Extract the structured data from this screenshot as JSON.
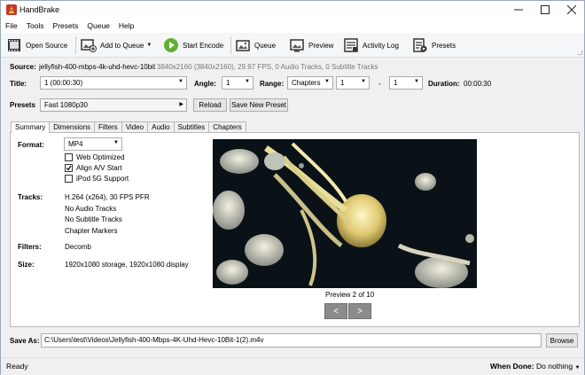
{
  "window": {
    "title": "HandBrake"
  },
  "menu": [
    "File",
    "Tools",
    "Presets",
    "Queue",
    "Help"
  ],
  "toolbar": {
    "open_source": "Open Source",
    "add_to_queue": "Add to Queue",
    "start_encode": "Start Encode",
    "queue": "Queue",
    "preview": "Preview",
    "activity_log": "Activity Log",
    "presets": "Presets"
  },
  "source": {
    "label": "Source:",
    "name": "jellyfish-400-mbps-4k-uhd-hevc-10bit",
    "details": "3840x2160 (3840x2160), 29.97 FPS, 0 Audio Tracks, 0 Subtitle Tracks"
  },
  "title_row": {
    "title_label": "Title:",
    "title_value": "1 (00:00:30)",
    "angle_label": "Angle:",
    "angle_value": "1",
    "range_label": "Range:",
    "range_value": "Chapters",
    "range_start": "1",
    "range_dash": "-",
    "range_end": "1",
    "duration_label": "Duration:",
    "duration_value": "00:00:30"
  },
  "presets_row": {
    "label": "Presets",
    "value": "Fast 1080p30",
    "reload": "Reload",
    "save_new": "Save New Preset"
  },
  "tabs": [
    "Summary",
    "Dimensions",
    "Filters",
    "Video",
    "Audio",
    "Subtitles",
    "Chapters"
  ],
  "summary": {
    "format_label": "Format:",
    "format_value": "MP4",
    "web_optimized": "Web Optimized",
    "web_optimized_checked": false,
    "align_av": "Align A/V Start",
    "align_av_checked": true,
    "ipod": "iPod 5G Support",
    "ipod_checked": false,
    "tracks_label": "Tracks:",
    "tracks": [
      "H.264 (x264), 30 FPS PFR",
      "No Audio Tracks",
      "No Subtitle Tracks",
      "Chapter Markers"
    ],
    "filters_label": "Filters:",
    "filters_value": "Decomb",
    "size_label": "Size:",
    "size_value": "1920x1080 storage, 1920x1080 display",
    "preview_caption": "Preview 2 of 10",
    "prev_btn": "<",
    "next_btn": ">"
  },
  "save_as": {
    "label": "Save As:",
    "path": "C:\\Users\\test\\Videos\\Jellyfish-400-Mbps-4K-Uhd-Hevc-10Bit-1(2).m4v",
    "browse": "Browse"
  },
  "status": {
    "text": "Ready",
    "when_done_label": "When Done:",
    "when_done_value": "Do nothing"
  },
  "colors": {
    "start_green": "#5fb030",
    "border": "#b9b9b9"
  }
}
